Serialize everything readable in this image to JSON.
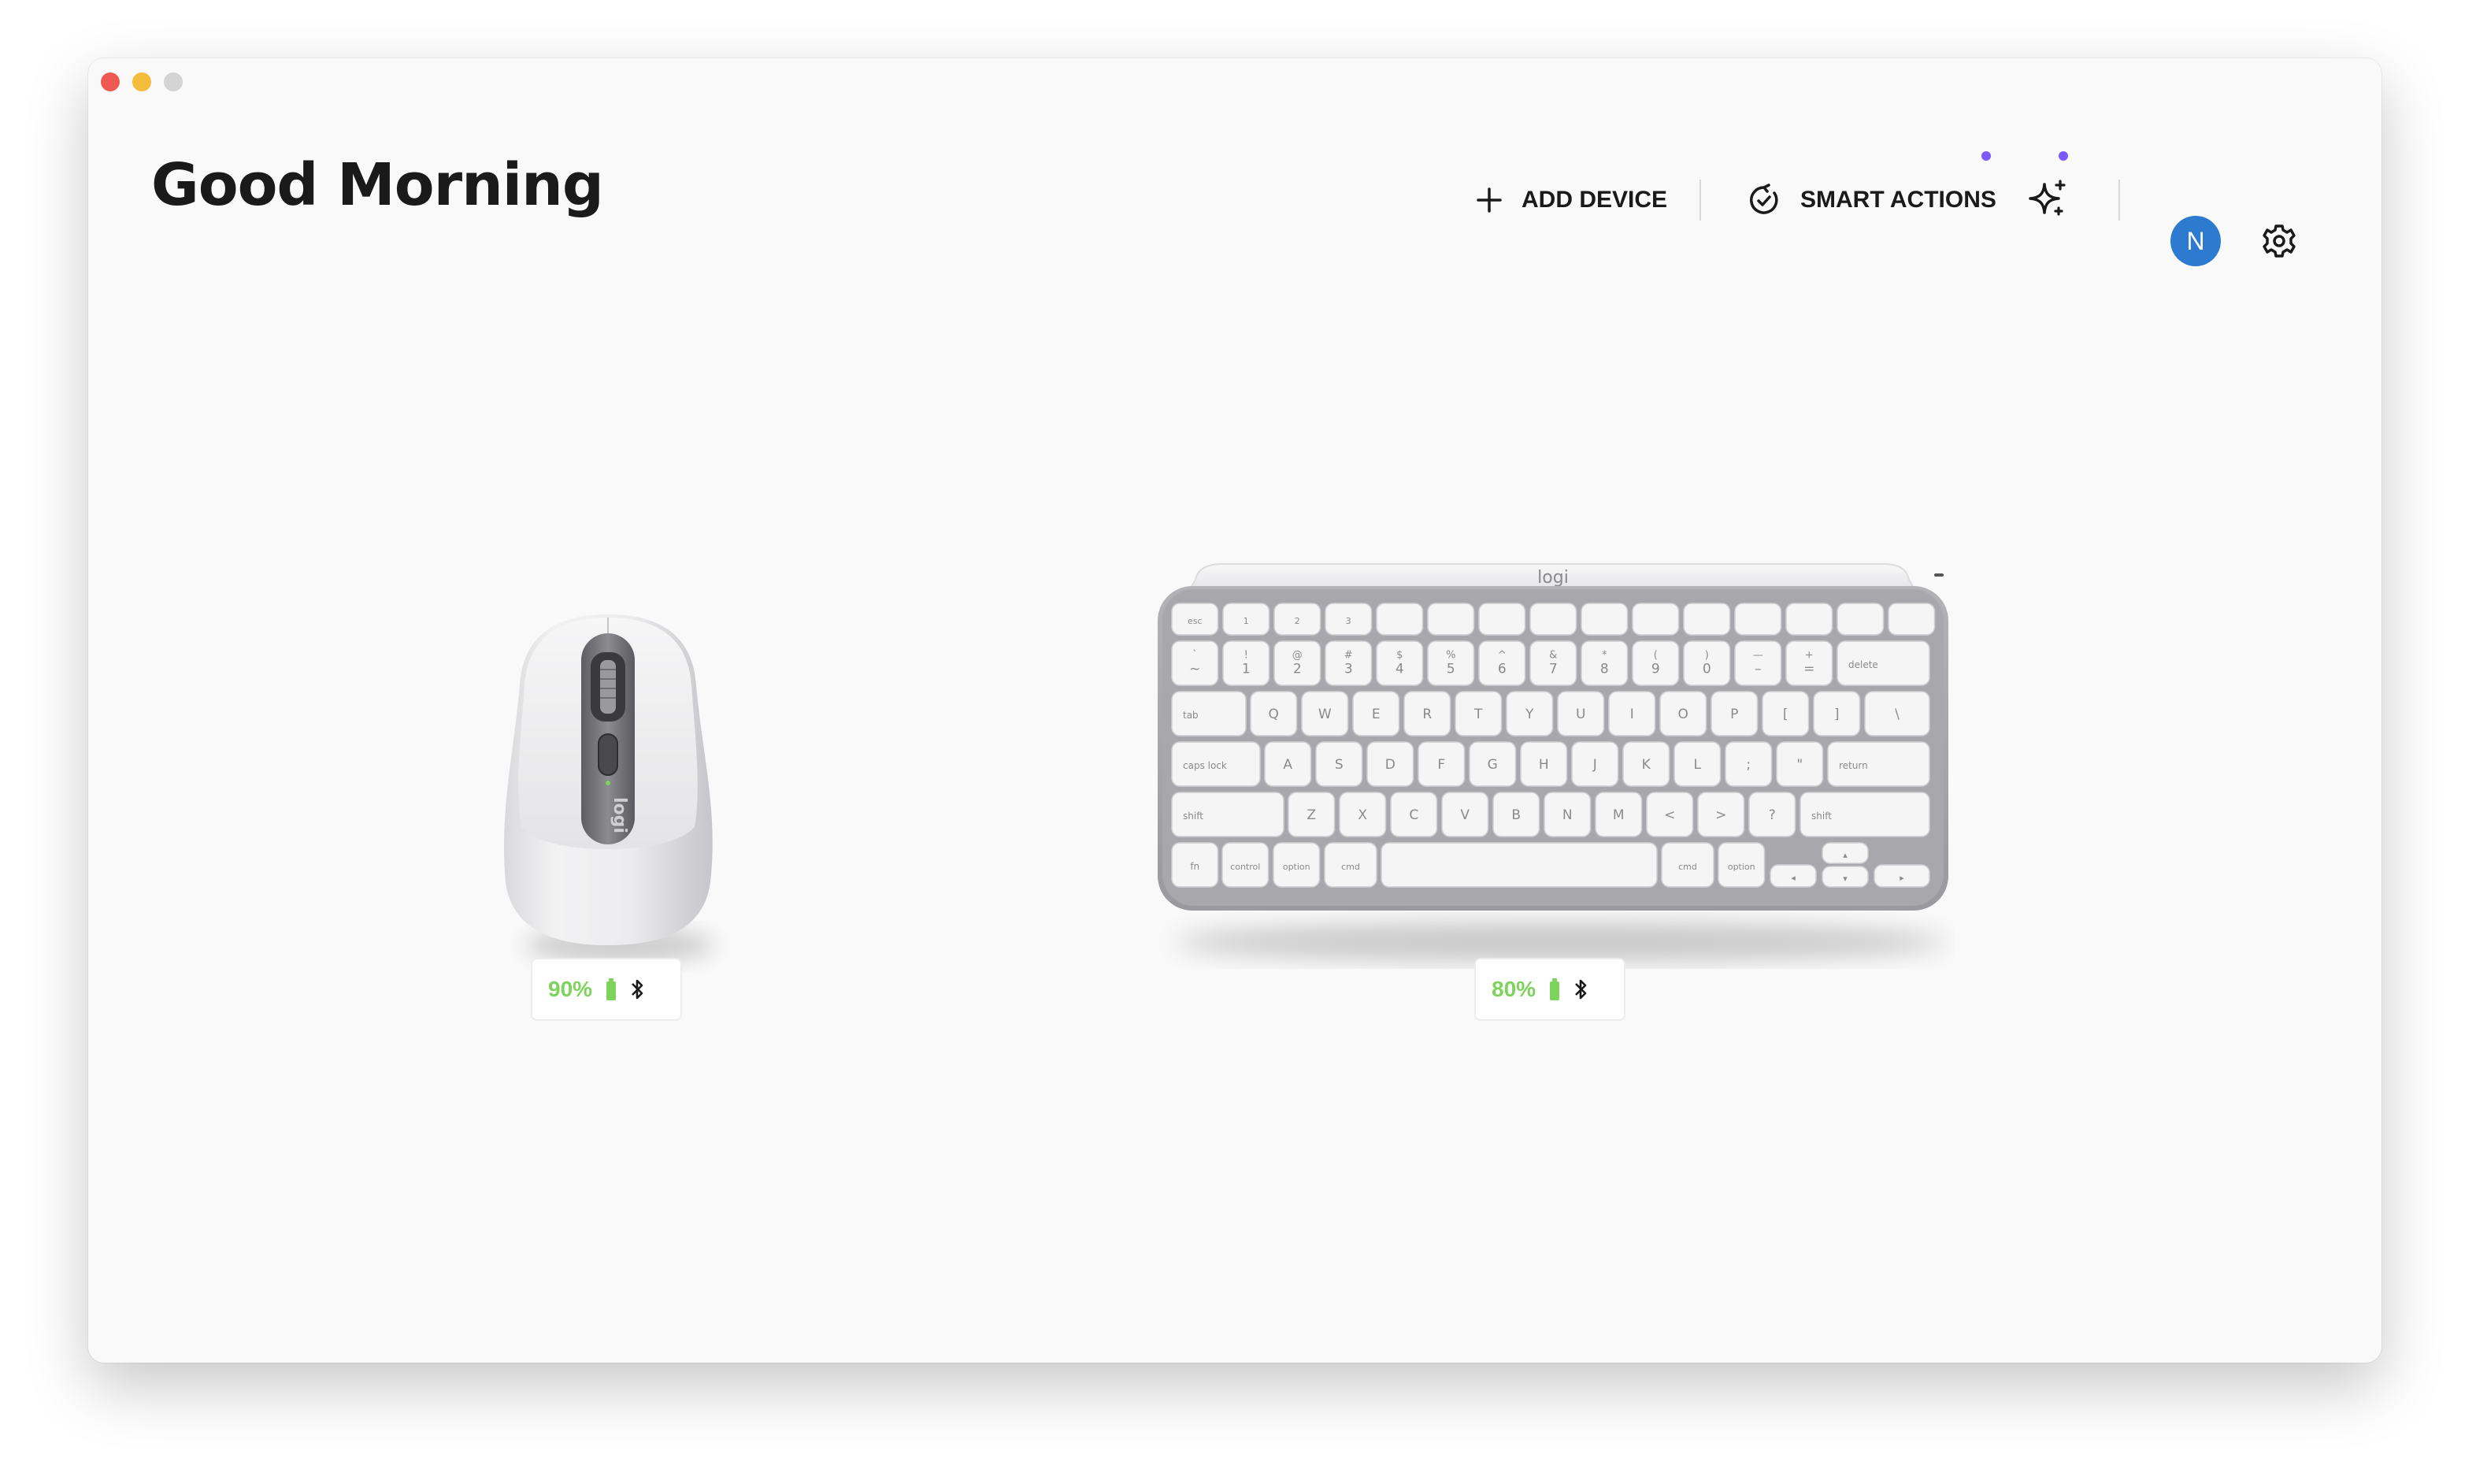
{
  "greeting": "Good Morning",
  "toolbar": {
    "add_device_label": "ADD DEVICE",
    "smart_actions_label": "SMART ACTIONS",
    "avatar_initial": "N"
  },
  "devices": [
    {
      "kind": "mouse",
      "battery": "90%",
      "battery_level": 0.9,
      "connection": "bluetooth-icon",
      "brand": "logi"
    },
    {
      "kind": "keyboard",
      "battery": "80%",
      "battery_level": 0.8,
      "connection": "bluetooth-icon",
      "brand": "logi"
    }
  ],
  "keyboard_keys": {
    "row0": [
      "esc",
      "1",
      "2",
      "3",
      "",
      "",
      "",
      "",
      "",
      "",
      "",
      "",
      "",
      "",
      ""
    ],
    "row1": [
      "~",
      "1",
      "2",
      "3",
      "4",
      "5",
      "6",
      "7",
      "8",
      "9",
      "0",
      "–",
      "=",
      "delete"
    ],
    "row1_shift": [
      "`",
      "!",
      "@",
      "#",
      "$",
      "%",
      "^",
      "&",
      "*",
      "(",
      ")",
      "—",
      "+",
      ""
    ],
    "row2": [
      "tab",
      "Q",
      "W",
      "E",
      "R",
      "T",
      "Y",
      "U",
      "I",
      "O",
      "P",
      "[",
      "]",
      "\\"
    ],
    "row3": [
      "caps lock",
      "A",
      "S",
      "D",
      "F",
      "G",
      "H",
      "J",
      "K",
      "L",
      ";",
      "\"",
      "return"
    ],
    "row4": [
      "shift",
      "Z",
      "X",
      "C",
      "V",
      "B",
      "N",
      "M",
      "<",
      ">",
      "?",
      "shift"
    ],
    "row5": [
      "fn",
      "control",
      "option",
      "cmd",
      "",
      "cmd",
      "option"
    ]
  },
  "colors": {
    "accent_green": "#7dd35c",
    "avatar_blue": "#2d7bd1",
    "notification_dot": "#7a5af8"
  }
}
